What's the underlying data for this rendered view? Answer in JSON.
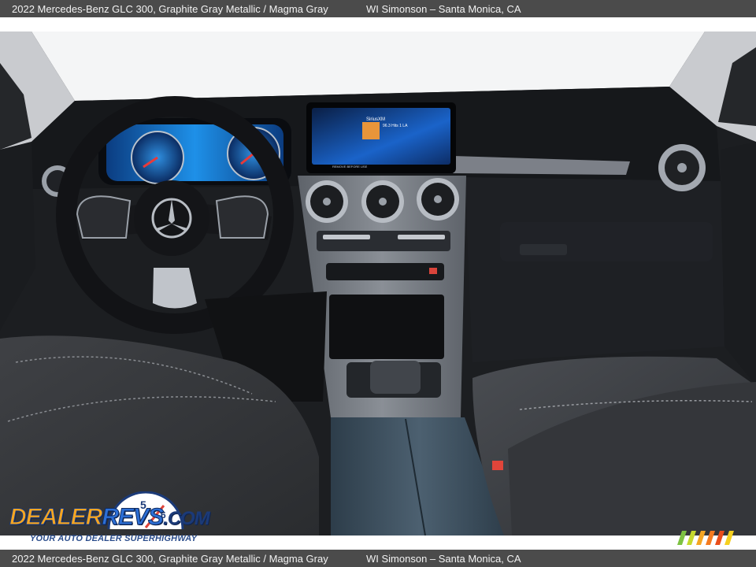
{
  "caption": {
    "title": "2022 Mercedes-Benz GLC 300,  Graphite Gray Metallic / Magma Gray",
    "dealer": "WI Simonson – Santa Monica, CA"
  },
  "photo": {
    "subject": "mercedes-benz-glc-dashboard-interior",
    "colors": {
      "dash": "#16181b",
      "trim": "#7c8088",
      "screen": "#1a63c9",
      "seat": "#3a3c40",
      "windshield": "#f4f5f6"
    }
  },
  "screen": {
    "media_title": "SiriusXM",
    "station": "96.3 Hits 1 LA",
    "footer": "REMOVE BEFORE USE"
  },
  "watermark": {
    "logo_dealer": "DEALER",
    "logo_revs": "REVS",
    "logo_com": ".COM",
    "tagline": "YOUR AUTO DEALER SUPERHIGHWAY",
    "gauge_digits": [
      "4",
      "5",
      "6"
    ],
    "colors": {
      "orange": "#f5a623",
      "blue": "#2c6fd6",
      "navy": "#1b3a78"
    }
  },
  "stripes": {
    "colors": [
      "#7dc242",
      "#c5d92d",
      "#f5a623",
      "#f47b20",
      "#e94e1b",
      "#f5d01f"
    ]
  }
}
